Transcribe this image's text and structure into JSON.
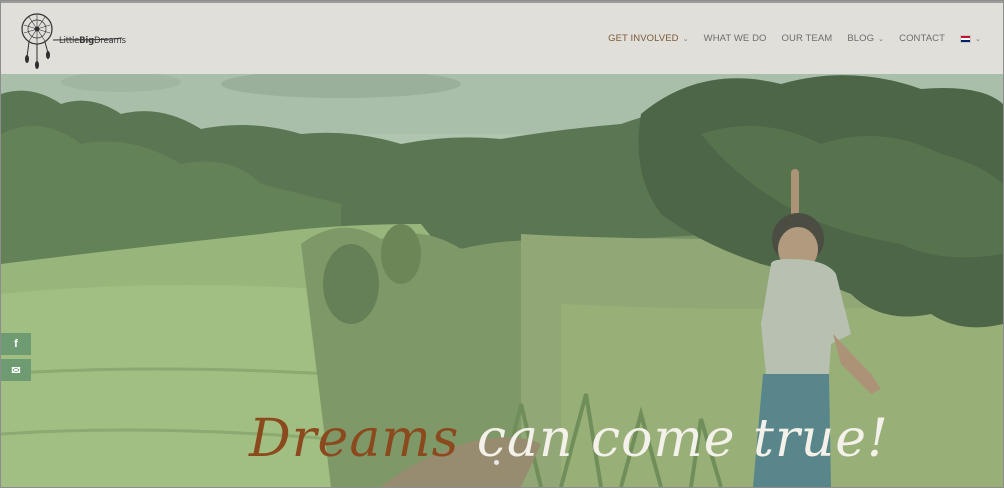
{
  "logo": {
    "text_prefix": "Little",
    "text_bold": "Big",
    "text_suffix": "Dreams"
  },
  "nav": {
    "items": [
      {
        "label": "GET INVOLVED",
        "has_dropdown": true,
        "active": true
      },
      {
        "label": "WHAT WE DO",
        "has_dropdown": false
      },
      {
        "label": "OUR TEAM",
        "has_dropdown": false
      },
      {
        "label": "BLOG",
        "has_dropdown": true
      },
      {
        "label": "CONTACT",
        "has_dropdown": false
      }
    ],
    "language_icon": "uk-flag-icon"
  },
  "social": {
    "facebook_glyph": "f",
    "mail_glyph": "✉"
  },
  "hero": {
    "tagline_highlight": "Dreams",
    "tagline_rest": " can come true!",
    "highlight_color": "#8b4a1d"
  },
  "colors": {
    "header_bg": "#e1dfda",
    "social_bg": "#6e9b72",
    "nav_active": "#7a5a38"
  }
}
